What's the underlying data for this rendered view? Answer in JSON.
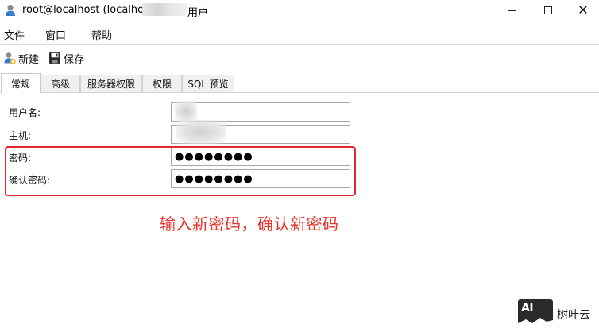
{
  "window": {
    "title_prefix": "root@localhost (localho",
    "title_suffix": " 用户",
    "minimize_icon": "minimize-icon",
    "maximize_icon": "maximize-icon",
    "close_glyph": "✕"
  },
  "menu": {
    "file": "文件",
    "window": "窗口",
    "help": "帮助"
  },
  "toolbar": {
    "new_label": "新建",
    "save_label": "保存"
  },
  "tabs": [
    {
      "label": "常规",
      "active": true
    },
    {
      "label": "高级",
      "active": false
    },
    {
      "label": "服务器权限",
      "active": false
    },
    {
      "label": "权限",
      "active": false
    },
    {
      "label": "SQL 预览",
      "active": false
    }
  ],
  "form": {
    "username_label": "用户名:",
    "username_value": "",
    "host_label": "主机:",
    "host_value": "",
    "password_label": "密码:",
    "password_value": "●●●●●●●●",
    "confirm_label": "确认密码:",
    "confirm_value": "●●●●●●●●"
  },
  "annotation": {
    "text": "输入新密码，确认新密码",
    "color": "#e8302a"
  },
  "watermark": {
    "logo_text": "AI",
    "brand_text": "树叶云"
  },
  "colors": {
    "highlight_border": "#e02a2a",
    "active_tab_bg": "#ffffff",
    "inactive_tab_bg": "#f0f0f0"
  }
}
